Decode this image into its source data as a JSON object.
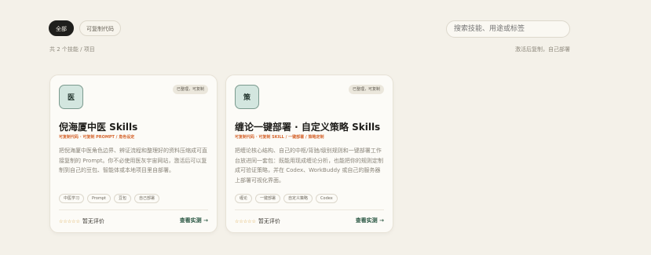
{
  "filters": [
    {
      "label": "全部",
      "active": true
    },
    {
      "label": "可复制代码",
      "active": false
    }
  ],
  "search": {
    "placeholder": "搜索技能、用途或标签"
  },
  "summary": {
    "count_text": "共 2 个技能 / 项目",
    "hint_text": "激活后复制，自己部署"
  },
  "cards": [
    {
      "avatar": "医",
      "status": "已整理，可复制",
      "title": "倪海厦中医 Skills",
      "subtitle": "可复制代码 · 可复制 PROMPT / 角色设定",
      "description": "把倪海厦中医角色边界、辨证流程和整理好的资料压缩成可直接复制的 Prompt。你不必使用医灰宇宙网站，激活后可以复制到自己的豆包、智能体或本地项目里自部署。",
      "tags": [
        "中医学习",
        "Prompt",
        "豆包",
        "自己部署"
      ],
      "stars": "☆☆☆☆☆",
      "rating_text": "暂无评价",
      "cta": "查看实测 →"
    },
    {
      "avatar": "策",
      "status": "已整理，可复制",
      "title": "缠论一键部署 · 自定义策略 Skills",
      "subtitle": "可复制代码 · 可复制 SKILL / 一键部署 / 策略定制",
      "description": "把缠论核心结构、自己的中枢/背驰/级别规则和一键部署工作台放进同一套包：既能用现成缠论分析，也能把你的规则定制成可验证策略，并在 Codex、WorkBuddy 或自己的服务器上部署可视化界面。",
      "tags": [
        "缠论",
        "一键部署",
        "自定义策略",
        "Codex"
      ],
      "stars": "☆☆☆☆☆",
      "rating_text": "暂无评价",
      "cta": "查看实测 →"
    }
  ]
}
